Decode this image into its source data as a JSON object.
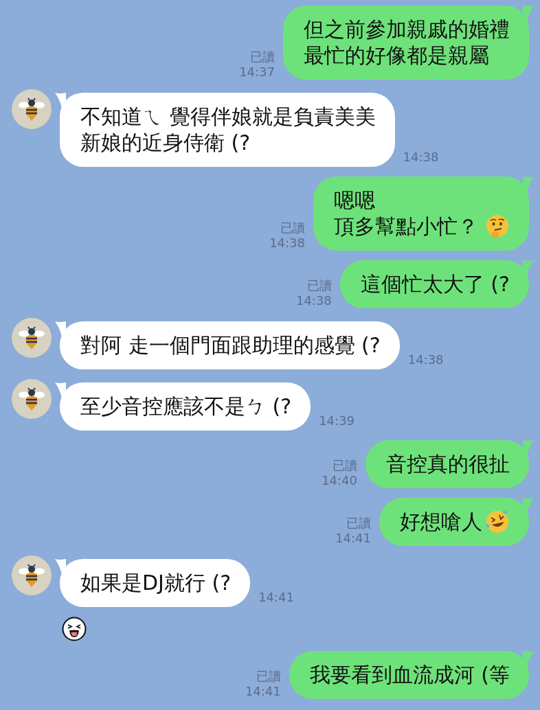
{
  "messages": [
    {
      "kind": "outgoing",
      "read_label": "已讀",
      "time": "14:37",
      "lines": [
        "但之前參加親戚的婚禮",
        "最忙的好像都是親屬"
      ]
    },
    {
      "kind": "incoming",
      "time": "14:38",
      "lines": [
        "不知道ㄟ 覺得伴娘就是負責美美",
        "新娘的近身侍衛 (?"
      ]
    },
    {
      "kind": "outgoing",
      "read_label": "已讀",
      "time": "14:38",
      "lines": [
        "嗯嗯",
        "頂多幫點小忙？"
      ],
      "emoji": {
        "kind": "thinking"
      }
    },
    {
      "kind": "outgoing",
      "read_label": "已讀",
      "time": "14:38",
      "lines": [
        "這個忙太大了 (?"
      ]
    },
    {
      "kind": "incoming",
      "time": "14:38",
      "lines": [
        "對阿 走一個門面跟助理的感覺 (?"
      ]
    },
    {
      "kind": "incoming",
      "time": "14:39",
      "lines": [
        "至少音控應該不是ㄅ (?"
      ]
    },
    {
      "kind": "outgoing",
      "read_label": "已讀",
      "time": "14:40",
      "lines": [
        "音控真的很扯"
      ]
    },
    {
      "kind": "outgoing",
      "read_label": "已讀",
      "time": "14:41",
      "lines": [
        "好想嗆人"
      ],
      "emoji": {
        "kind": "laughing"
      }
    },
    {
      "kind": "incoming",
      "time": "14:41",
      "lines": [
        "如果是DJ就行 (?"
      ],
      "reaction": {
        "kind": "laughing"
      }
    },
    {
      "kind": "outgoing",
      "read_label": "已讀",
      "time": "14:41",
      "lines": [
        "我要看到血流成河 (等"
      ]
    }
  ]
}
